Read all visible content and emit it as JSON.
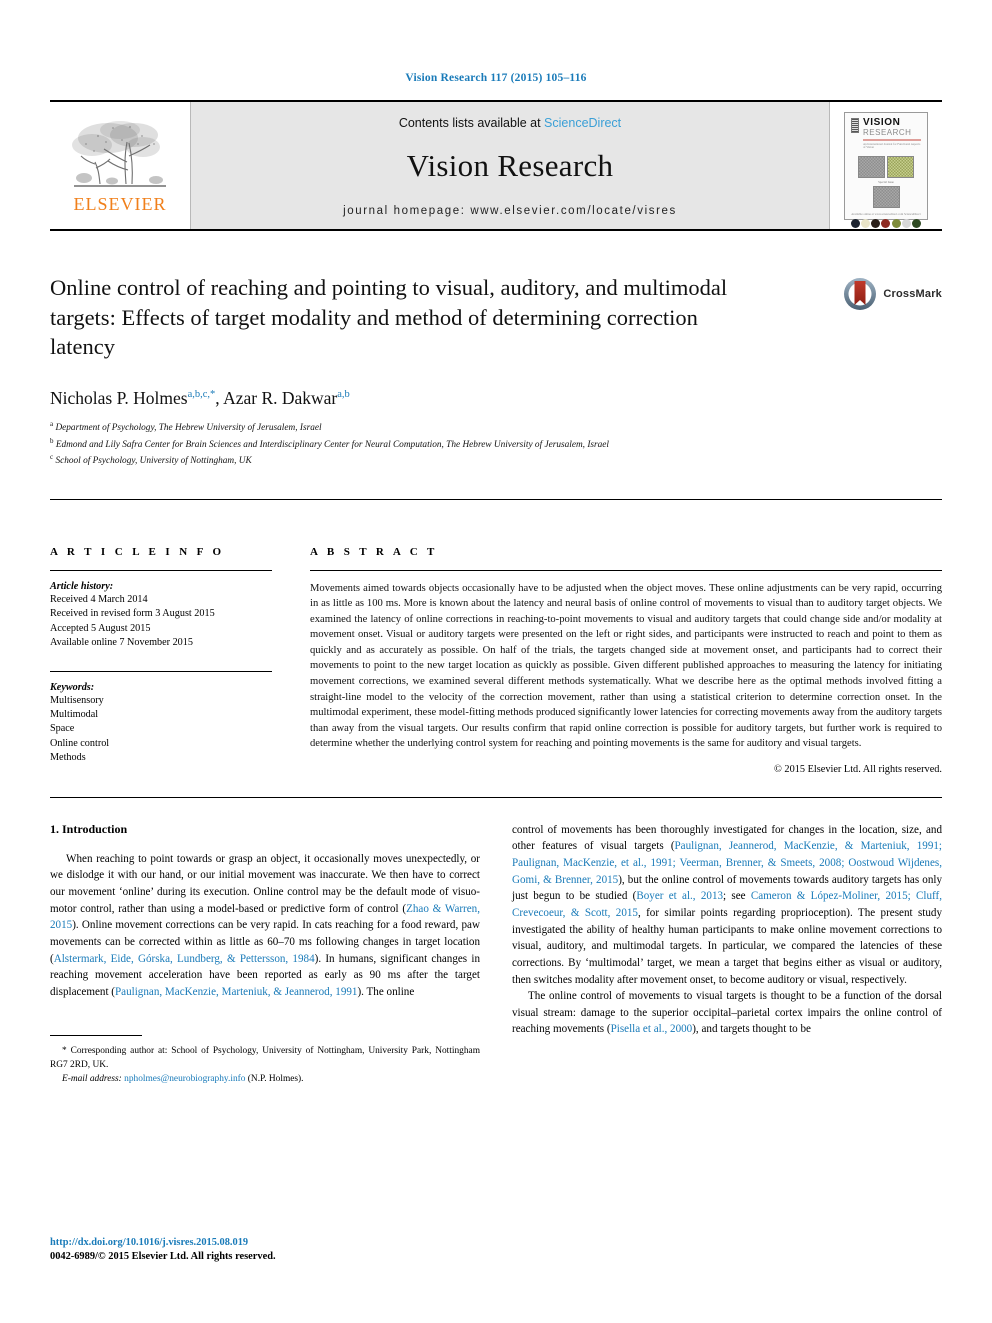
{
  "running_head": "Vision Research 117 (2015) 105–116",
  "masthead": {
    "publisher_logo_name": "elsevier-tree-logo",
    "publisher_wordmark": "ELSEVIER",
    "contents_prefix": "Contents lists available at ",
    "contents_link": "ScienceDirect",
    "journal_name": "Vision Research",
    "homepage_label": "journal homepage: www.elsevier.com/locate/visres",
    "cover": {
      "title_line1": "VISION",
      "title_line2": "RESEARCH",
      "subtitle": "An International Journal for Functional Aspects of Vision",
      "caption": "Special Issue",
      "footer": "Available online at www.sciencedirect.com  ScienceDirect"
    }
  },
  "article": {
    "title": "Online control of reaching and pointing to visual, auditory, and multimodal targets: Effects of target modality and method of determining correction latency",
    "crossmark_label": "CrossMark",
    "authors": [
      {
        "name": "Nicholas P. Holmes",
        "marks": "a,b,c,*"
      },
      {
        "name": "Azar R. Dakwar",
        "marks": "a,b"
      }
    ],
    "authors_separator": ", ",
    "affiliations": [
      {
        "mark": "a",
        "text": "Department of Psychology, The Hebrew University of Jerusalem, Israel"
      },
      {
        "mark": "b",
        "text": "Edmond and Lily Safra Center for Brain Sciences and Interdisciplinary Center for Neural Computation, The Hebrew University of Jerusalem, Israel"
      },
      {
        "mark": "c",
        "text": "School of Psychology, University of Nottingham, UK"
      }
    ]
  },
  "article_info": {
    "section_label": "A R T I C L E    I N F O",
    "history_label": "Article history:",
    "history": [
      "Received 4 March 2014",
      "Received in revised form 3 August 2015",
      "Accepted 5 August 2015",
      "Available online 7 November 2015"
    ],
    "keywords_label": "Keywords:",
    "keywords": [
      "Multisensory",
      "Multimodal",
      "Space",
      "Online control",
      "Methods"
    ]
  },
  "abstract": {
    "section_label": "A B S T R A C T",
    "text": "Movements aimed towards objects occasionally have to be adjusted when the object moves. These online adjustments can be very rapid, occurring in as little as 100 ms. More is known about the latency and neural basis of online control of movements to visual than to auditory target objects. We examined the latency of online corrections in reaching-to-point movements to visual and auditory targets that could change side and/or modality at movement onset. Visual or auditory targets were presented on the left or right sides, and participants were instructed to reach and point to them as quickly and as accurately as possible. On half of the trials, the targets changed side at movement onset, and participants had to correct their movements to point to the new target location as quickly as possible. Given different published approaches to measuring the latency for initiating movement corrections, we examined several different methods systematically. What we describe here as the optimal methods involved fitting a straight-line model to the velocity of the correction movement, rather than using a statistical criterion to determine correction onset. In the multimodal experiment, these model-fitting methods produced significantly lower latencies for correcting movements away from the auditory targets than away from the visual targets. Our results confirm that rapid online correction is possible for auditory targets, but further work is required to determine whether the underlying control system for reaching and pointing movements is the same for auditory and visual targets.",
    "copyright": "© 2015 Elsevier Ltd. All rights reserved."
  },
  "body": {
    "intro_heading": "1. Introduction",
    "left_paragraph_1": {
      "pre": "When reaching to point towards or grasp an object, it occasionally moves unexpectedly, or we dislodge it with our hand, or our initial movement was inaccurate. We then have to correct our movement ‘online’ during its execution. Online control may be the default mode of visuo-motor control, rather than using a model-based or predictive form of control (",
      "cite1": "Zhao & Warren, 2015",
      "mid1": "). Online movement corrections can be very rapid. In cats reaching for a food reward, paw movements can be corrected within as little as 60–70 ms following changes in target location (",
      "cite2": "Alstermark, Eide, Górska, Lundberg, & Pettersson, 1984",
      "mid2": "). In humans, significant changes in reaching movement acceleration have been reported as early as 90 ms after the target displacement (",
      "cite3": "Paulignan, MacKenzie, Marteniuk, & Jeannerod, 1991",
      "post": "). The online"
    },
    "right_paragraph_1": {
      "pre": "control of movements has been thoroughly investigated for changes in the location, size, and other features of visual targets (",
      "cite1": "Paulignan, Jeannerod, MacKenzie, & Marteniuk, 1991; Paulignan, MacKenzie, et al., 1991; Veerman, Brenner, & Smeets, 2008; Oostwoud Wijdenes, Gomi, & Brenner, 2015",
      "mid1": "), but the online control of movements towards auditory targets has only just begun to be studied (",
      "cite2": "Boyer et al., 2013",
      "mid2": "; see ",
      "cite3": "Cameron & López-Moliner, 2015; Cluff, Crevecoeur, & Scott, 2015",
      "post": ", for similar points regarding proprioception). The present study investigated the ability of healthy human participants to make online movement corrections to visual, auditory, and multimodal targets. In particular, we compared the latencies of these corrections. By ‘multimodal’ target, we mean a target that begins either as visual or auditory, then switches modality after movement onset, to become auditory or visual, respectively."
    },
    "right_paragraph_2": {
      "pre": "The online control of movements to visual targets is thought to be a function of the dorsal visual stream: damage to the superior occipital–parietal cortex impairs the online control of reaching movements (",
      "cite1": "Pisella et al., 2000",
      "post": "), and targets thought to be"
    }
  },
  "footnote": {
    "corresponding_mark": "*",
    "corresponding_text": " Corresponding author at: School of Psychology, University of Nottingham, University Park, Nottingham RG7 2RD, UK.",
    "email_label": "E-mail address:",
    "email": "npholmes@neurobiography.info",
    "email_owner": " (N.P. Holmes)."
  },
  "bottom": {
    "doi": "http://dx.doi.org/10.1016/j.visres.2015.08.019",
    "issn": "0042-6989/© 2015 Elsevier Ltd. All rights reserved."
  },
  "colors": {
    "link": "#1a7bb9",
    "science_direct": "#3a9fd6",
    "elsevier_orange": "#f07f1a",
    "band_gray": "#e6e6e6",
    "crossmark_red": "#b0291f"
  }
}
